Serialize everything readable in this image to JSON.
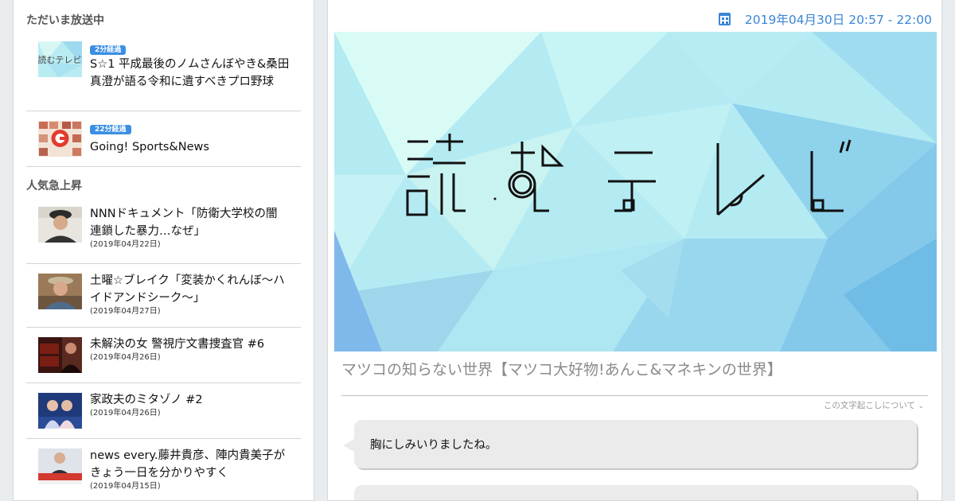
{
  "sidebar": {
    "now_on_air_title": "ただいま放送中",
    "now_on_air": [
      {
        "badge": "2分経過",
        "title": "S☆1 平成最後のノムさんぼやき&桑田真澄が語る令和に遺すべきプロ野球"
      },
      {
        "badge": "22分経過",
        "title": "Going! Sports&News"
      }
    ],
    "trending_title": "人気急上昇",
    "trending": [
      {
        "title": "NNNドキュメント「防衛大学校の闇 連鎖した暴力…なぜ」",
        "date": "(2019年04月22日)"
      },
      {
        "title": "土曜☆ブレイク「変装かくれんぼ～ハイドアンドシーク～」",
        "date": "(2019年04月27日)"
      },
      {
        "title": "未解決の女 警視庁文書捜査官 #6",
        "date": "(2019年04月26日)"
      },
      {
        "title": "家政夫のミタゾノ #2",
        "date": "(2019年04月26日)"
      },
      {
        "title": "news every.藤井貴彦、陣内貴美子がきょう一日を分かりやすく",
        "date": "(2019年04月15日)"
      }
    ]
  },
  "main": {
    "airtime": "2019年04月30日 20:57 - 22:00",
    "hero_logo_text": "読むテレビ",
    "program_title": "マツコの知らない世界【マツコ大好物!あんこ&マネキンの世界】",
    "about_link": "この文字起こしについて",
    "transcript": [
      {
        "text": "胸にしみいりましたね。"
      },
      {
        "text": ""
      }
    ]
  },
  "colors": {
    "accent": "#3a86d6",
    "badge": "#3b8fe3",
    "hero_light": "#dff8f4",
    "hero_blue": "#7cc3ea"
  },
  "icons": {
    "calendar": "calendar-icon",
    "chevron": "chevron-down-icon"
  }
}
